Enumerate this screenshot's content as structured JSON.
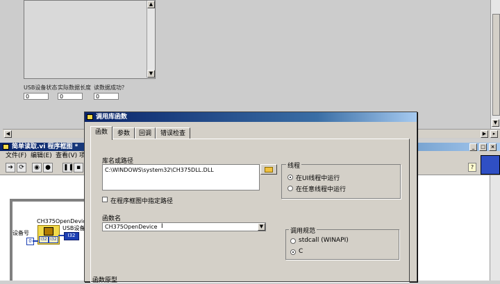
{
  "front_panel": {
    "indicators": [
      {
        "label": "USB设备状态",
        "value": "0"
      },
      {
        "label": "实际数据长度",
        "value": "0"
      },
      {
        "label": "读数据成功？",
        "value": "0"
      }
    ]
  },
  "block_diagram": {
    "title": "简单读取.vi 程序框图 *",
    "menu": [
      "文件(F)",
      "编辑(E)",
      "查看(V)",
      "项"
    ],
    "window_buttons": [
      "_",
      "□",
      "×"
    ],
    "nodes": {
      "call_node_label": "CH375OpenDevice",
      "device_label": "设备号",
      "usb_label": "USB设备",
      "const_value": "0",
      "num_type": "I32",
      "i32_badge": "I32",
      "small_badge": "I32"
    }
  },
  "dialog": {
    "title": "调用库函数",
    "tabs": [
      "函数",
      "参数",
      "回调",
      "错误检查"
    ],
    "active_tab": 0,
    "library_path": {
      "label": "库名或路径",
      "value": "C:\\WINDOWS\\system32\\CH375DLL.DLL"
    },
    "specify_path_checkbox": {
      "label": "在程序框图中指定路径",
      "checked": false
    },
    "function_name": {
      "label": "函数名",
      "value": "CH375OpenDevice"
    },
    "thread": {
      "label": "线程",
      "options": [
        "在UI线程中运行",
        "在任意线程中运行"
      ],
      "selected": 0
    },
    "calling_convention": {
      "label": "调用规范",
      "options": [
        "stdcall (WINAPI)",
        "C"
      ],
      "selected": 1
    },
    "bottom_label": "函数原型"
  },
  "colors": {
    "title_bar": "#0a246a",
    "dialog_bg": "#d4d0c8",
    "node_yellow": "#f1d94a",
    "wire_blue": "#1b3fb3"
  }
}
